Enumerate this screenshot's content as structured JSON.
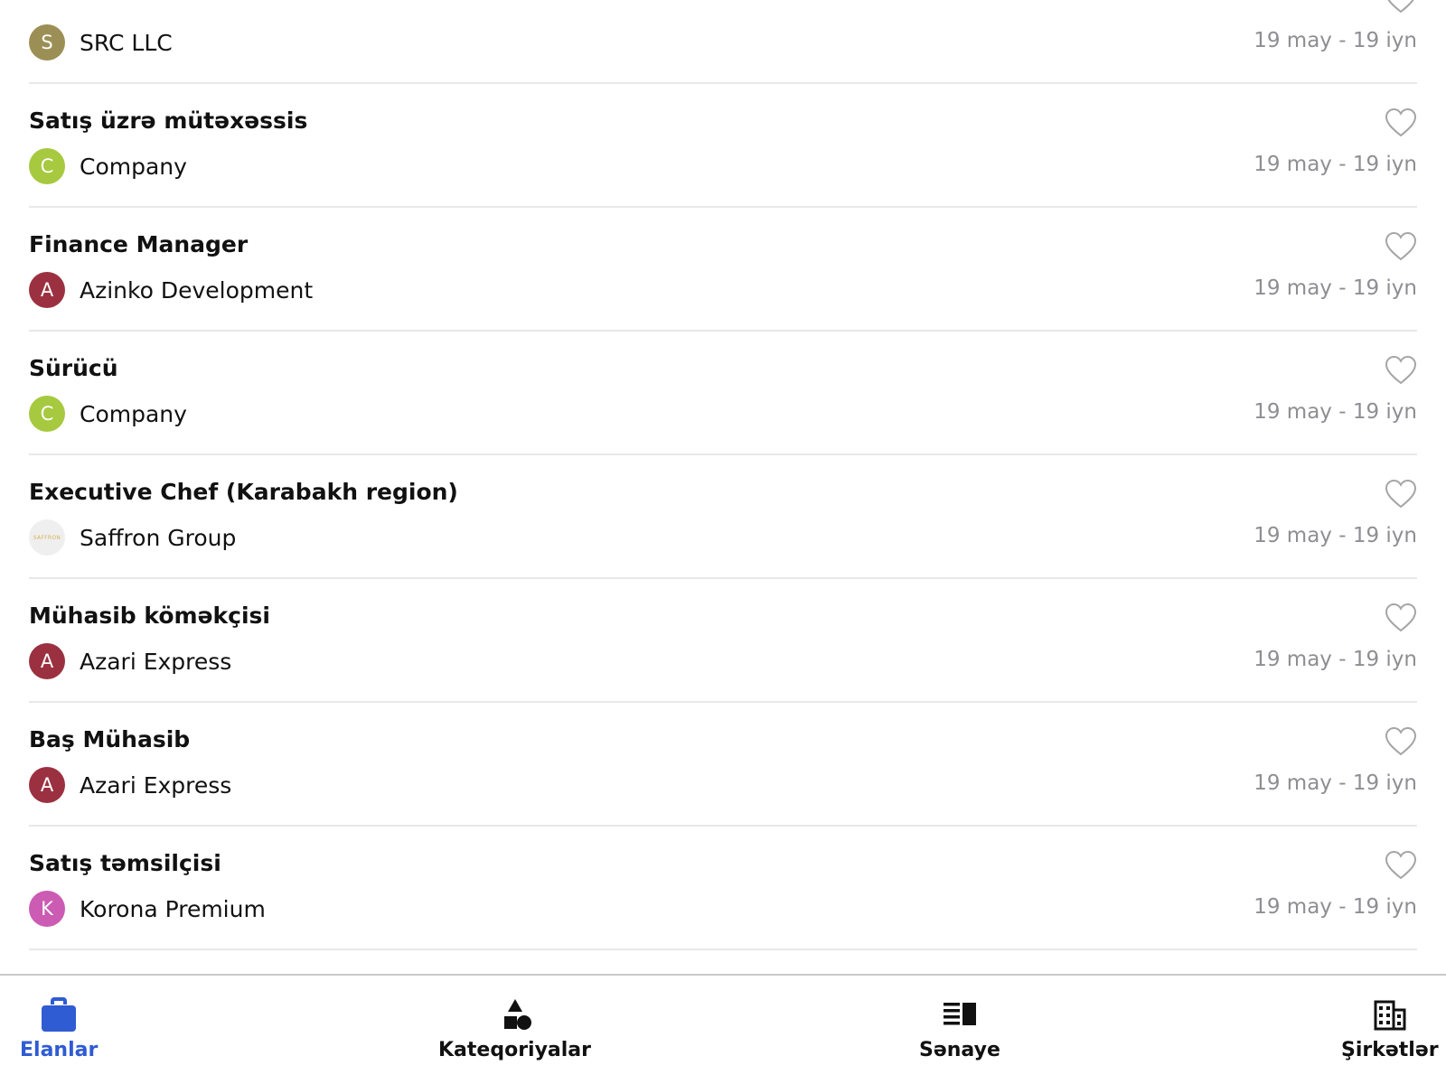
{
  "colors": {
    "accent": "#2f5bd3",
    "date_text": "#8e8e93",
    "divider": "#e8e8e8"
  },
  "jobs": [
    {
      "title": "",
      "company": "SRC LLC",
      "initial": "S",
      "avatar_color": "#9c8f55",
      "date": "19 may - 19 iyn"
    },
    {
      "title": "Satış üzrə mütəxəssis",
      "company": "Company",
      "initial": "C",
      "avatar_color": "#a6c93f",
      "date": "19 may - 19 iyn"
    },
    {
      "title": "Finance Manager",
      "company": "Azinko Development",
      "initial": "A",
      "avatar_color": "#9b3140",
      "date": "19 may - 19 iyn"
    },
    {
      "title": "Sürücü",
      "company": "Company",
      "initial": "C",
      "avatar_color": "#a6c93f",
      "date": "19 may - 19 iyn"
    },
    {
      "title": "Executive Chef (Karabakh region)",
      "company": "Saffron Group",
      "initial": "SAFFRON",
      "avatar_color": "#efefef",
      "logo": true,
      "date": "19 may - 19 iyn"
    },
    {
      "title": "Mühasib köməkçisi",
      "company": "Azari Express",
      "initial": "A",
      "avatar_color": "#9b3140",
      "date": "19 may - 19 iyn"
    },
    {
      "title": "Baş Mühasib",
      "company": "Azari Express",
      "initial": "A",
      "avatar_color": "#9b3140",
      "date": "19 may - 19 iyn"
    },
    {
      "title": "Satış təmsilçisi",
      "company": "Korona Premium",
      "initial": "K",
      "avatar_color": "#cc5bb3",
      "date": "19 may - 19 iyn"
    }
  ],
  "tabbar": {
    "tabs": [
      {
        "label": "Elanlar",
        "icon": "briefcase-icon",
        "active": true
      },
      {
        "label": "Kateqoriyalar",
        "icon": "shapes-icon",
        "active": false
      },
      {
        "label": "Sənaye",
        "icon": "industry-list-icon",
        "active": false
      },
      {
        "label": "Şirkətlər",
        "icon": "building-icon",
        "active": false
      }
    ]
  }
}
